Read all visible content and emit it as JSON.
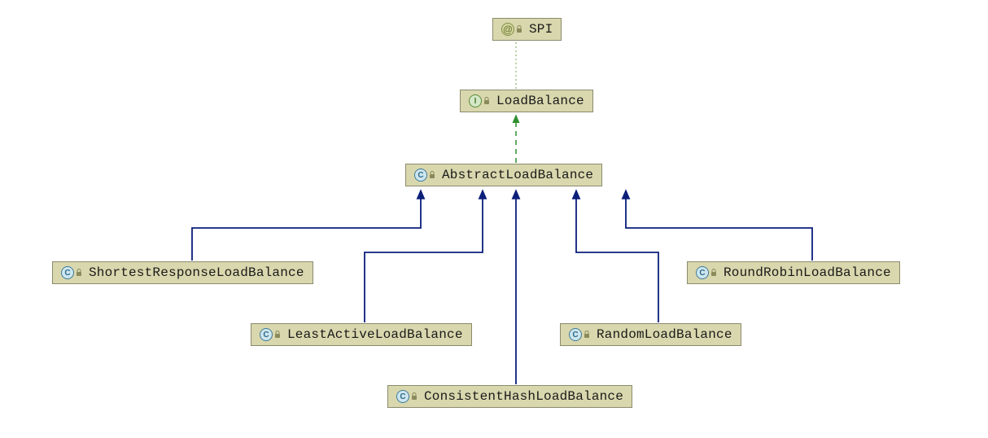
{
  "nodes": {
    "spi": {
      "label": "SPI",
      "type": "annotation"
    },
    "lb": {
      "label": "LoadBalance",
      "type": "interface"
    },
    "abstract": {
      "label": "AbstractLoadBalance",
      "type": "class"
    },
    "shortest": {
      "label": "ShortestResponseLoadBalance",
      "type": "class"
    },
    "least": {
      "label": "LeastActiveLoadBalance",
      "type": "class"
    },
    "consistent": {
      "label": "ConsistentHashLoadBalance",
      "type": "class"
    },
    "random": {
      "label": "RandomLoadBalance",
      "type": "class"
    },
    "round": {
      "label": "RoundRobinLoadBalance",
      "type": "class"
    }
  },
  "edges": [
    {
      "from": "lb",
      "to": "spi",
      "style": "dotted-green"
    },
    {
      "from": "abstract",
      "to": "lb",
      "style": "dashed-green-arrow"
    },
    {
      "from": "shortest",
      "to": "abstract",
      "style": "solid-navy-arrow"
    },
    {
      "from": "least",
      "to": "abstract",
      "style": "solid-navy-arrow"
    },
    {
      "from": "consistent",
      "to": "abstract",
      "style": "solid-navy-arrow"
    },
    {
      "from": "random",
      "to": "abstract",
      "style": "solid-navy-arrow"
    },
    {
      "from": "round",
      "to": "abstract",
      "style": "solid-navy-arrow"
    }
  ],
  "colors": {
    "node_bg": "#d9d7ad",
    "navy": "#001a66",
    "green": "#2f8f2f"
  }
}
